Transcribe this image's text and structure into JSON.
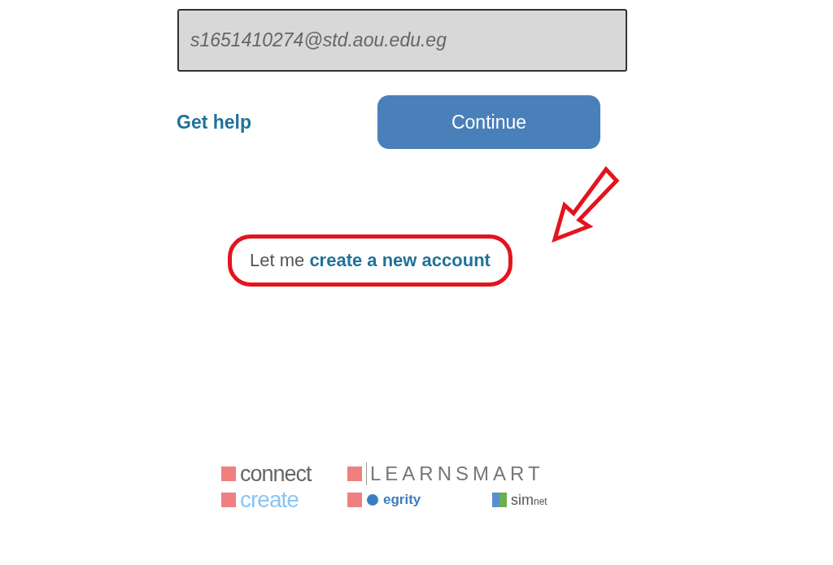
{
  "email_field": {
    "value": "s1651410274@std.aou.edu.eg",
    "disabled": true
  },
  "help_link": "Get help",
  "continue_button": "Continue",
  "create_account": {
    "prefix": "Let me",
    "link": "create a new account",
    "highlighted": true
  },
  "logos": [
    {
      "kind": "connect",
      "text": "connect"
    },
    {
      "kind": "learnsmart",
      "text": "LEARNSMART"
    },
    {
      "kind": "create",
      "text": "create"
    },
    {
      "kind": "tegrity",
      "text": "egrity"
    },
    {
      "kind": "simnet",
      "text": "sim",
      "suffix": "net"
    }
  ]
}
